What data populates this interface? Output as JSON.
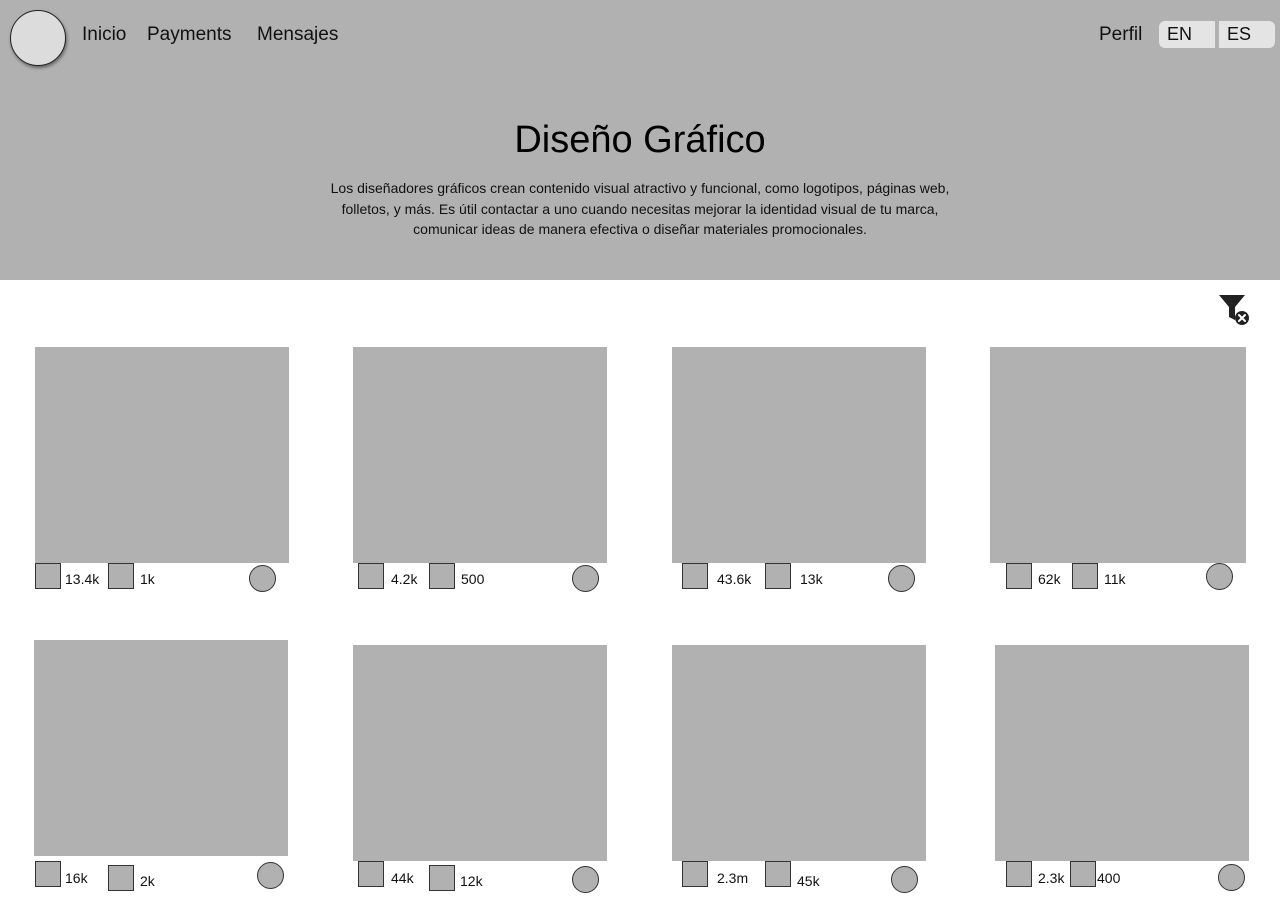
{
  "nav": {
    "items": [
      "Inicio",
      "Payments",
      "Mensajes"
    ],
    "profile": "Perfil",
    "languages": [
      "EN",
      "ES"
    ]
  },
  "hero": {
    "title": "Diseño Gráfico",
    "description": "Los diseñadores gráficos crean contenido visual atractivo y funcional, como logotipos, páginas web, folletos, y más. Es útil contactar a uno cuando necesitas mejorar la identidad visual de tu marca, comunicar ideas de manera efectiva o diseñar materiales promocionales."
  },
  "filter": {
    "icon": "filter-clear-icon"
  },
  "cards": [
    {
      "stat1": "13.4k",
      "stat2": "1k"
    },
    {
      "stat1": "4.2k",
      "stat2": "500"
    },
    {
      "stat1": "43.6k",
      "stat2": "13k"
    },
    {
      "stat1": "62k",
      "stat2": "11k"
    },
    {
      "stat1": "16k",
      "stat2": "2k"
    },
    {
      "stat1": "44k",
      "stat2": "12k"
    },
    {
      "stat1": "2.3m",
      "stat2": "45k"
    },
    {
      "stat1": "2.3k",
      "stat2": "400"
    }
  ],
  "colors": {
    "placeholder": "#b1b1b1",
    "avatar": "#dcdcdc",
    "language_button": "#e4e4e4"
  }
}
